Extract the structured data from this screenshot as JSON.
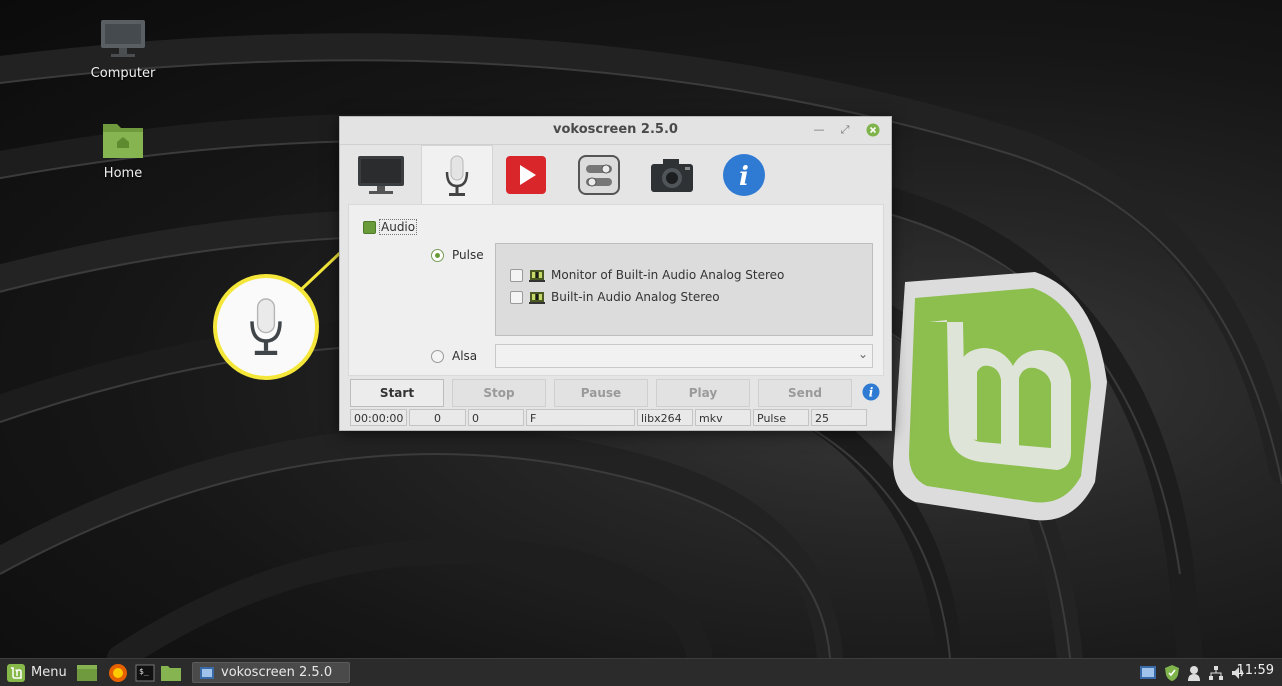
{
  "desktop": {
    "icons": [
      {
        "label": "Computer",
        "icon": "monitor-icon"
      },
      {
        "label": "Home",
        "icon": "home-folder-icon"
      }
    ]
  },
  "window": {
    "title": "vokoscreen 2.5.0",
    "tabs": [
      {
        "name": "screen-tab",
        "icon": "monitor-icon"
      },
      {
        "name": "audio-tab",
        "icon": "microphone-icon",
        "active": true
      },
      {
        "name": "video-tab",
        "icon": "play-icon"
      },
      {
        "name": "settings-tab",
        "icon": "toggle-switches-icon"
      },
      {
        "name": "webcam-tab",
        "icon": "camera-icon"
      },
      {
        "name": "about-tab",
        "icon": "info-icon"
      }
    ],
    "audio": {
      "label": "Audio",
      "checked": true,
      "pulse_label": "Pulse",
      "alsa_label": "Alsa",
      "devices": [
        {
          "label": "Monitor of Built-in Audio Analog Stereo",
          "checked": false
        },
        {
          "label": "Built-in Audio Analog Stereo",
          "checked": false
        }
      ]
    },
    "buttons": {
      "start": "Start",
      "stop": "Stop",
      "pause": "Pause",
      "play": "Play",
      "send": "Send"
    },
    "status": {
      "time": "00:00:00",
      "field2": "0",
      "field3": "0",
      "field4": "F",
      "codec": "libx264",
      "container": "mkv",
      "audio": "Pulse",
      "fps": "25"
    }
  },
  "taskbar": {
    "menu_label": "Menu",
    "window_button": "vokoscreen 2.5.0",
    "clock": "11:59"
  },
  "colors": {
    "callout": "#f4e73a",
    "mint_green": "#87b84a",
    "accent_green": "#6a9b3a"
  }
}
